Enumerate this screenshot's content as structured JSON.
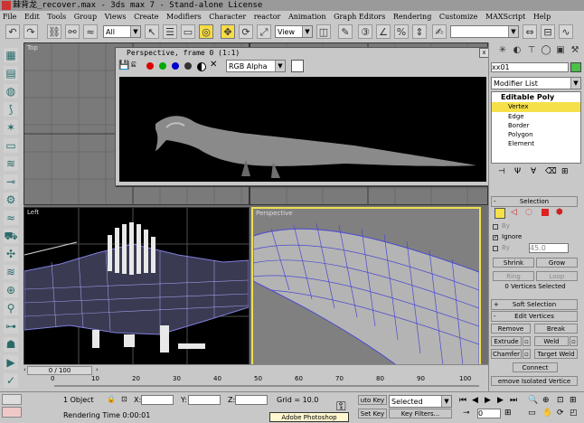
{
  "window": {
    "title": "棘背龙_recover.max - 3ds max 7  - Stand-alone License"
  },
  "menu": [
    "File",
    "Edit",
    "Tools",
    "Group",
    "Views",
    "Create",
    "Modifiers",
    "Character",
    "reactor",
    "Animation",
    "Graph Editors",
    "Rendering",
    "Customize",
    "MAXScript",
    "Help"
  ],
  "toolbar": {
    "selection_filter": "All",
    "reference_coord": "View"
  },
  "viewports": {
    "top_label": "Top",
    "left_label": "Left",
    "perspective_label": "Perspective"
  },
  "render_frame": {
    "title": "Perspective, frame 0 (1:1)",
    "channel": "RGB Alpha",
    "close": "x"
  },
  "command_panel": {
    "object_name": "xx01",
    "modifier_list": "Modifier List",
    "stack": [
      {
        "label": "Editable Poly",
        "selected": false,
        "top": true
      },
      {
        "label": "Vertex",
        "selected": true
      },
      {
        "label": "Edge",
        "selected": false
      },
      {
        "label": "Border",
        "selected": false
      },
      {
        "label": "Polygon",
        "selected": false
      },
      {
        "label": "Element",
        "selected": false
      }
    ],
    "selection": {
      "header": "Selection",
      "by_label": "By",
      "ignore_label": "Ignore",
      "by_angle_label": "By",
      "angle_value": "45.0",
      "shrink": "Shrink",
      "grow": "Grow",
      "ring": "Ring",
      "loop": "Loop",
      "status": "0 Vertices Selected"
    },
    "soft_selection": {
      "header": "Soft Selection"
    },
    "edit_vertices": {
      "header": "Edit Vertices",
      "remove": "Remove",
      "break": "Break",
      "extrude": "Extrude",
      "weld": "Weld",
      "chamfer": "Chamfer",
      "target_weld": "Target Weld",
      "connect": "Connect",
      "remove_isolated": "emove Isolated Vertice"
    }
  },
  "timeline": {
    "frame_counter": "0 / 100",
    "ticks": [
      "0",
      "10",
      "20",
      "30",
      "40",
      "50",
      "60",
      "70",
      "80",
      "90",
      "100"
    ]
  },
  "status": {
    "objects": "1 Object",
    "x_label": "X:",
    "y_label": "Y:",
    "z_label": "Z:",
    "grid": "Grid = 10.0",
    "rendering_time": "Rendering Time  0:00:01",
    "auto_key": "uto Key",
    "selected": "Selected",
    "set_key": "Set Key",
    "key_filters": "Key Filters...",
    "frame": "0"
  },
  "taskbar": {
    "tooltip": "Adobe Photoshop"
  },
  "colors": {
    "selected_stack": "#f5e04a",
    "viewport_bg": "#7a7a7a",
    "active_border": "#f0e050",
    "wire_blue": "#4a4ad0"
  }
}
